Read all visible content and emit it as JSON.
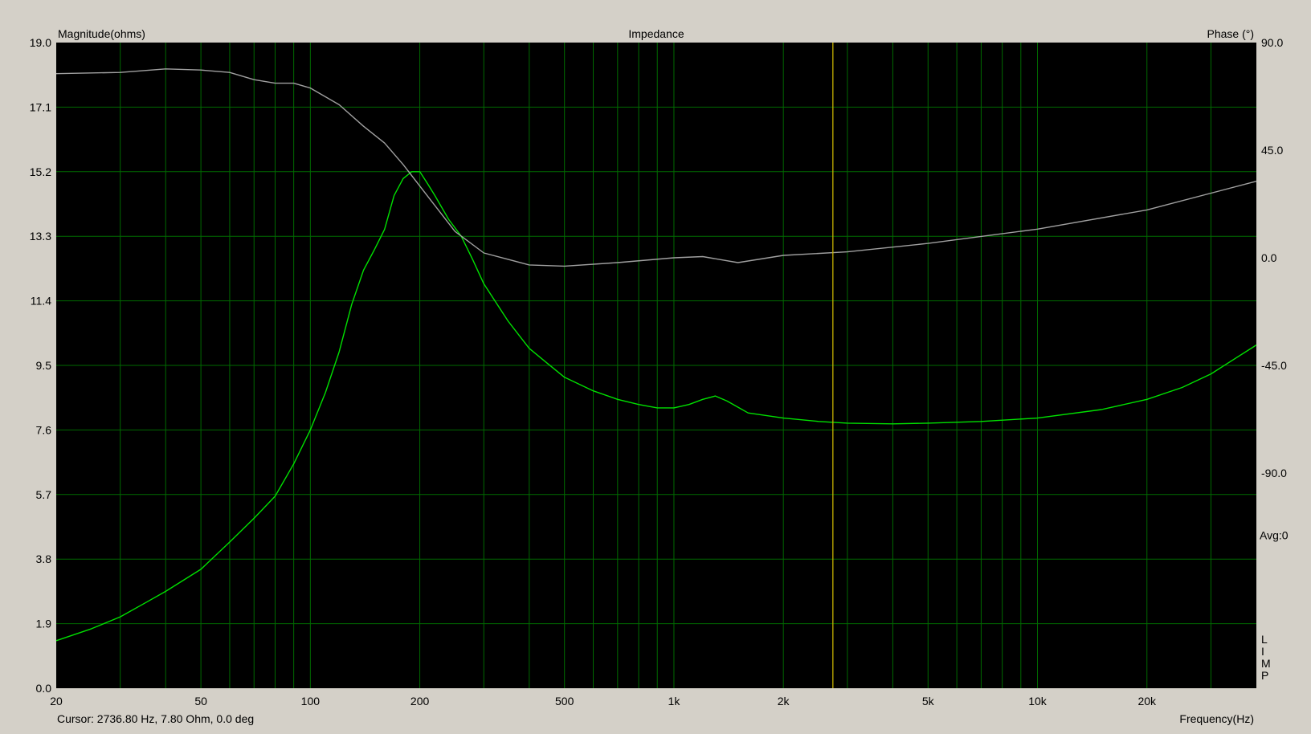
{
  "chart_data": {
    "type": "line",
    "title": "Impedance",
    "ylabel_left": "Magnitude(ohms)",
    "ylabel_right": "Phase (°)",
    "xlabel": "Frequency(Hz)",
    "x_scale": "log",
    "xlim": [
      20,
      40000
    ],
    "ylim_left": [
      0,
      19
    ],
    "ylim_right": [
      -180,
      90
    ],
    "grid": true,
    "y_ticks_left": [
      "0.0",
      "1.9",
      "3.8",
      "5.7",
      "7.6",
      "9.5",
      "11.4",
      "13.3",
      "15.2",
      "17.1",
      "19.0"
    ],
    "y_ticks_left_values": [
      0,
      1.9,
      3.8,
      5.7,
      7.6,
      9.5,
      11.4,
      13.3,
      15.2,
      17.1,
      19.0
    ],
    "y_ticks_right": [
      "90.0",
      "45.0",
      "0.0",
      "-45.0",
      "-90.0"
    ],
    "y_ticks_right_values": [
      90,
      45,
      0,
      -45,
      -90
    ],
    "x_tick_labels": [
      {
        "label": "20",
        "value": 20
      },
      {
        "label": "50",
        "value": 50
      },
      {
        "label": "100",
        "value": 100
      },
      {
        "label": "200",
        "value": 200
      },
      {
        "label": "500",
        "value": 500
      },
      {
        "label": "1k",
        "value": 1000
      },
      {
        "label": "2k",
        "value": 2000
      },
      {
        "label": "5k",
        "value": 5000
      },
      {
        "label": "10k",
        "value": 10000
      },
      {
        "label": "20k",
        "value": 20000
      }
    ],
    "avg_label": "Avg:0",
    "side_label": [
      "L",
      "I",
      "M",
      "P"
    ],
    "cursor_text": "Cursor: 2736.80 Hz, 7.80 Ohm, 0.0 deg",
    "cursor_x": 2736.8,
    "colors": {
      "plot_bg": "#000000",
      "grid": "#006a00",
      "magnitude": "#00e000",
      "phase": "#a0a0a0",
      "cursor": "#c8b400",
      "frame": "#d4d0c8"
    },
    "series": [
      {
        "key": "magnitude",
        "axis": "left",
        "x": [
          20,
          25,
          30,
          35,
          40,
          50,
          60,
          70,
          80,
          90,
          100,
          110,
          120,
          130,
          140,
          150,
          160,
          170,
          180,
          190,
          200,
          210,
          220,
          240,
          260,
          280,
          300,
          350,
          400,
          450,
          500,
          600,
          700,
          800,
          900,
          1000,
          1100,
          1200,
          1300,
          1400,
          1600,
          2000,
          2500,
          3000,
          4000,
          5000,
          7000,
          10000,
          15000,
          20000,
          25000,
          30000,
          40000
        ],
        "values": [
          1.4,
          1.75,
          2.1,
          2.5,
          2.85,
          3.5,
          4.3,
          5.0,
          5.65,
          6.6,
          7.6,
          8.7,
          9.9,
          11.3,
          12.3,
          12.9,
          13.5,
          14.5,
          15.0,
          15.2,
          15.2,
          14.85,
          14.5,
          13.8,
          13.3,
          12.6,
          11.9,
          10.8,
          10.0,
          9.55,
          9.15,
          8.75,
          8.5,
          8.35,
          8.25,
          8.25,
          8.35,
          8.5,
          8.6,
          8.45,
          8.1,
          7.95,
          7.85,
          7.8,
          7.78,
          7.8,
          7.85,
          7.95,
          8.2,
          8.5,
          8.85,
          9.25,
          10.1
        ]
      },
      {
        "key": "phase",
        "axis": "right",
        "x": [
          20,
          30,
          40,
          50,
          60,
          70,
          80,
          90,
          100,
          120,
          140,
          160,
          180,
          200,
          250,
          300,
          400,
          500,
          700,
          1000,
          1200,
          1500,
          2000,
          3000,
          5000,
          10000,
          20000,
          40000
        ],
        "values": [
          77,
          77.5,
          79,
          78.5,
          77.5,
          74.5,
          73,
          73,
          71,
          64,
          55,
          48,
          39,
          30,
          11,
          2,
          -3,
          -3.5,
          -2,
          0,
          0.5,
          -2,
          1,
          2.5,
          6,
          12,
          20,
          32
        ]
      }
    ]
  }
}
